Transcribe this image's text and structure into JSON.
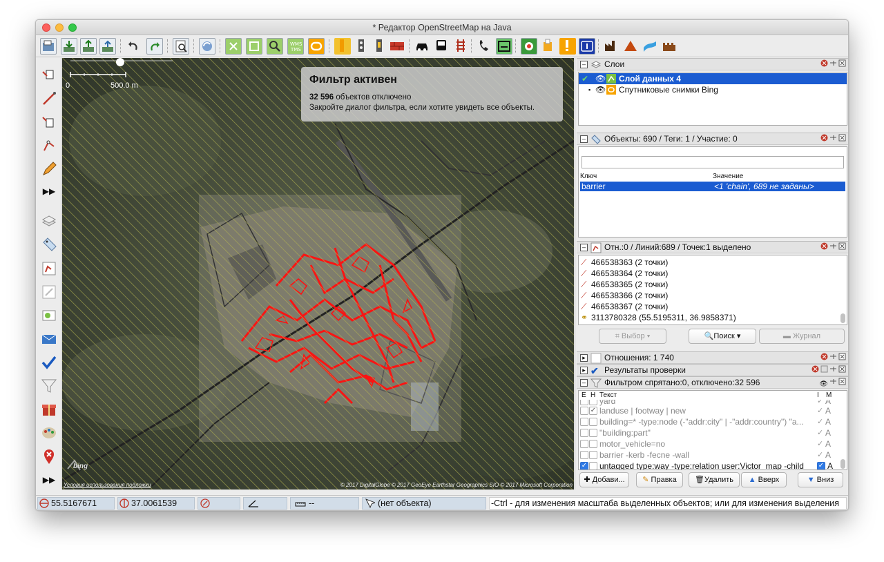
{
  "window": {
    "title": "* Редактор OpenStreetMap на Java"
  },
  "toolbar": {
    "icons": [
      "open-file",
      "download",
      "upload",
      "save",
      "undo",
      "redo",
      "preferences",
      "update-data",
      "zoom-data",
      "zoom-selection",
      "find",
      "wms",
      "relation-editor",
      "railway",
      "rail-lights",
      "level-crossing",
      "wall",
      "car",
      "bus",
      "rail",
      "phone",
      "wall-2",
      "recycling",
      "shop",
      "warning",
      "info",
      "industrial",
      "mountain",
      "river",
      "castle"
    ]
  },
  "left_tools": [
    "select",
    "draw",
    "zoom",
    "improve-way",
    "draw-pencil",
    "more",
    "toggle-layers",
    "tags",
    "selection-list",
    "relations",
    "filter-edit",
    "messages",
    "validation",
    "filter",
    "presents",
    "paint-style",
    "map-marker",
    "more-2"
  ],
  "map": {
    "scale": {
      "zero": "0",
      "distance": "500.0 m"
    },
    "filter_notice": {
      "title": "Фильтр активен",
      "count": "32 596",
      "count_suffix": "объектов отключено",
      "hint": "Закройте диалог фильтра, если хотите увидеть все объекты."
    },
    "terms_link": "Условия использования подложки",
    "attribution": "© 2017 DigitalGlobe © 2017 GeoEye Earthstar Geographics SIO © 2017 Microsoft Corporation",
    "logo_text": "bing"
  },
  "layers_panel": {
    "title": "Слои",
    "items": [
      {
        "label": "Слой данных 4",
        "active": true
      },
      {
        "label": "Спутниковые снимки Bing",
        "active": false
      }
    ]
  },
  "tags_panel": {
    "title": "Объекты: 690 / Теги: 1 / Участие: 0",
    "search_value": "",
    "col_key": "Ключ",
    "col_value": "Значение",
    "rows": [
      {
        "key": "barrier",
        "value": "<1 'chain', 689 не заданы>"
      }
    ]
  },
  "selection_panel": {
    "title": "Отн.:0 / Линий:689 / Точек:1 выделено",
    "items": [
      "466538363 (2 точки)",
      "466538364 (2 точки)",
      "466538365 (2 точки)",
      "466538366 (2 точки)",
      "466538367 (2 точки)",
      "3113780328 (55.5195311, 36.9858371)"
    ],
    "btn_select": "Выбор",
    "btn_search": "Поиск",
    "btn_history": "Журнал"
  },
  "relations_panel": {
    "title": "Отношения: 1 740"
  },
  "validation_panel": {
    "title": "Результаты проверки"
  },
  "filter_panel": {
    "title": "Фильтром спрятано:0, отключено:32 596",
    "col_e": "E",
    "col_h": "H",
    "col_text": "Текст",
    "col_i": "I",
    "col_m": "M",
    "rows": [
      {
        "text": "yard",
        "e": false,
        "h": false,
        "i": true,
        "m": "A"
      },
      {
        "text": "landuse | footway | new",
        "e": false,
        "h": true,
        "i": true,
        "m": "A"
      },
      {
        "text": "building=* -type:node (-\"addr:city\" | -\"addr:country\") \"a...",
        "e": false,
        "h": false,
        "i": true,
        "m": "A"
      },
      {
        "text": "\"building:part\"",
        "e": false,
        "h": false,
        "i": true,
        "m": "A"
      },
      {
        "text": "motor_vehicle=no",
        "e": false,
        "h": false,
        "i": true,
        "m": "A"
      },
      {
        "text": "barrier -kerb -fecne -wall",
        "e": false,
        "h": false,
        "i": true,
        "m": "A"
      },
      {
        "text": "untagged type:way -type:relation user:Victor_map -child",
        "e": true,
        "h": false,
        "i": true,
        "m": "A"
      }
    ],
    "btn_add": "Добави...",
    "btn_edit": "Правка",
    "btn_delete": "Удалить",
    "btn_up": "Вверх",
    "btn_down": "Вниз"
  },
  "statusbar": {
    "lat": "55.5167671",
    "lon": "37.0061539",
    "dist": "--",
    "object": "(нет объекта)",
    "hint": "-Ctrl - для изменения масштаба выделенных объектов; или для изменения выделения"
  },
  "colors": {
    "selection": "#1b5cd1",
    "highlight_red": "#ff1010",
    "hatch": "#b6b650",
    "status_field": "#d2dde8"
  }
}
